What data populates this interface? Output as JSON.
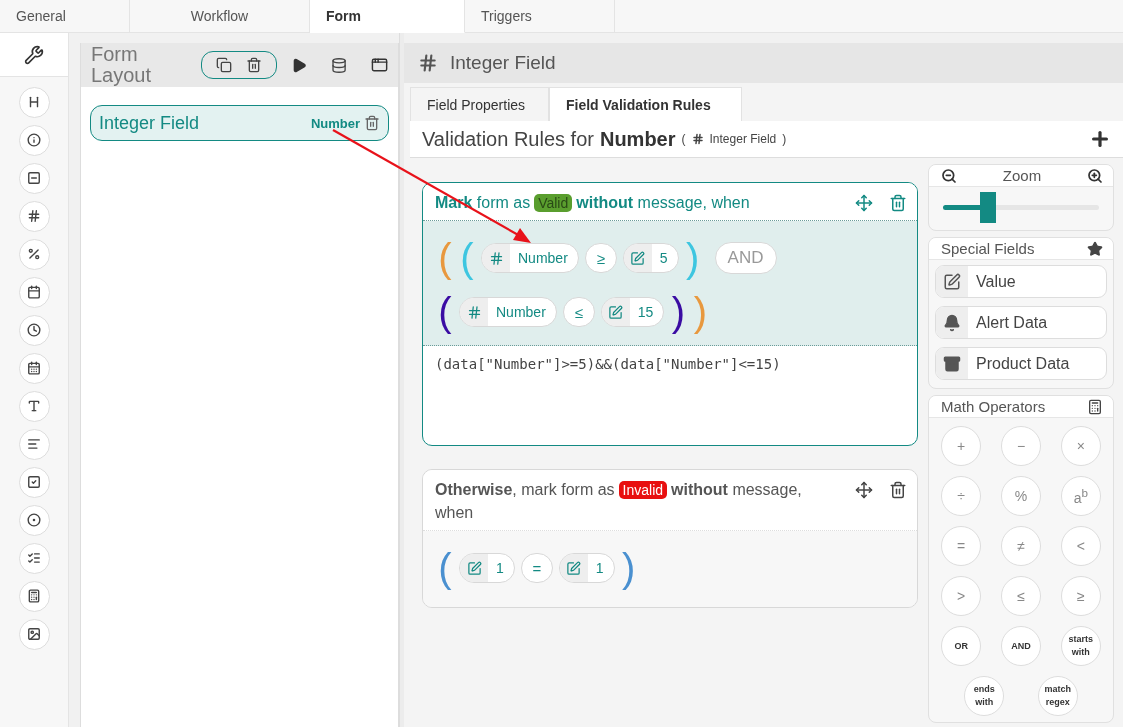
{
  "tabs": [
    {
      "label": "General",
      "selected": false
    },
    {
      "label": "Workflow",
      "selected": false
    },
    {
      "label": "Form",
      "selected": true
    },
    {
      "label": "Triggers",
      "selected": false
    }
  ],
  "form_layout": {
    "title": "Form Layout",
    "fields": [
      {
        "label": "Integer Field",
        "type": "Number",
        "selected": true
      }
    ]
  },
  "field_header": {
    "title": "Integer Field"
  },
  "field_tabs": [
    {
      "label": "Field Properties",
      "selected": false
    },
    {
      "label": "Field Validation Rules",
      "selected": true
    }
  ],
  "rules_title": {
    "lead": "Validation Rules for",
    "field": "Number",
    "paren_open": "(",
    "field_label": "Integer Field",
    "paren_close": ")"
  },
  "rules": [
    {
      "kind": "valid",
      "lead": "**Mark** form as",
      "badge": "Valid",
      "trail": "**without** message,",
      "tail": "when",
      "rows": [
        [
          {
            "kind": "paren",
            "text": "(",
            "color": "#e8983e"
          },
          {
            "kind": "paren",
            "text": "(",
            "color": "#3ec6e0"
          },
          {
            "kind": "field",
            "text": "Number"
          },
          {
            "kind": "operator",
            "text": "≥"
          },
          {
            "kind": "value",
            "text": "5"
          },
          {
            "kind": "paren",
            "text": ")",
            "color": "#3ec6e0"
          },
          {
            "kind": "logic",
            "text": "AND"
          }
        ],
        [
          {
            "kind": "paren",
            "text": "(",
            "color": "#3a0ca3"
          },
          {
            "kind": "field",
            "text": "Number"
          },
          {
            "kind": "operator",
            "text": "≤"
          },
          {
            "kind": "value",
            "text": "15"
          },
          {
            "kind": "paren",
            "text": ")",
            "color": "#3a0ca3"
          },
          {
            "kind": "paren",
            "text": ")",
            "color": "#e8983e"
          }
        ]
      ],
      "expression": "(data[\"Number\"]>=5)&&(data[\"Number\"]<=15)"
    },
    {
      "kind": "otherwise",
      "lead": "**Otherwise**, mark form as",
      "badge": "Invalid",
      "trail": "**without** message,",
      "tail": "when",
      "rows": [
        [
          {
            "kind": "paren",
            "text": "(",
            "color": "#4a90d0"
          },
          {
            "kind": "value",
            "text": "1"
          },
          {
            "kind": "operator",
            "text": "="
          },
          {
            "kind": "value",
            "text": "1"
          },
          {
            "kind": "paren",
            "text": ")",
            "color": "#4a90d0"
          }
        ]
      ]
    }
  ],
  "zoom": {
    "title": "Zoom",
    "level": 0.29
  },
  "special_fields": {
    "title": "Special Fields",
    "items": [
      {
        "label": "Value",
        "kind": "value"
      },
      {
        "label": "Alert Data",
        "kind": "alert"
      },
      {
        "label": "Product Data",
        "kind": "product"
      }
    ]
  },
  "math_operators": {
    "title": "Math Operators",
    "items": [
      {
        "text": "+",
        "kind": "symbol"
      },
      {
        "text": "−",
        "kind": "symbol"
      },
      {
        "text": "×",
        "kind": "symbol"
      },
      {
        "text": "÷",
        "kind": "symbol"
      },
      {
        "text": "%",
        "kind": "symbol"
      },
      {
        "text": "a$^{b}$",
        "kind": "symbol"
      },
      {
        "text": "=",
        "kind": "symbol"
      },
      {
        "text": "≠",
        "kind": "symbol"
      },
      {
        "text": "<",
        "kind": "symbol"
      },
      {
        "text": ">",
        "kind": "symbol"
      },
      {
        "text": "≤",
        "kind": "symbol"
      },
      {
        "text": "≥",
        "kind": "symbol"
      },
      {
        "text": "OR",
        "kind": "word"
      },
      {
        "text": "AND",
        "kind": "word"
      },
      {
        "text": "starts with",
        "kind": "word"
      },
      {
        "text": "ends with",
        "kind": "word"
      },
      {
        "text": "match regex",
        "kind": "word"
      }
    ]
  }
}
